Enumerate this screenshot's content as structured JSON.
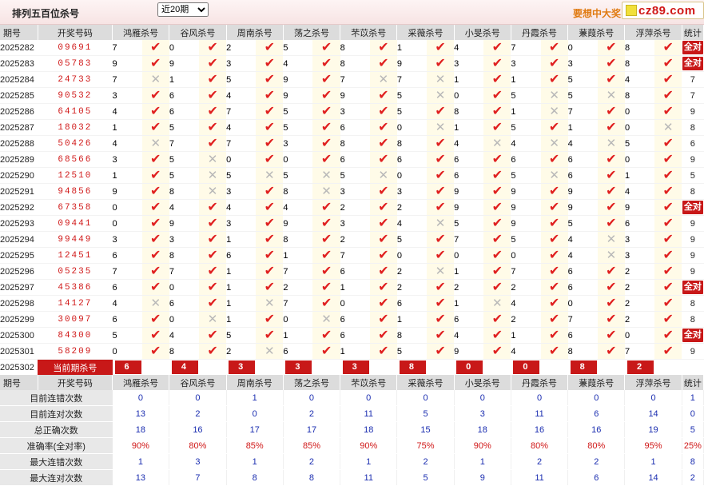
{
  "header": {
    "title": "排列五百位杀号",
    "select_value": "近20期",
    "select_options": [
      "近20期"
    ],
    "promo": "要想中大奖",
    "logo": "cz89.com"
  },
  "columns": {
    "period": "期号",
    "draw": "开奖号码",
    "experts": [
      "鸿雁杀号",
      "谷风杀号",
      "周南杀号",
      "荡之杀号",
      "芣苡杀号",
      "采薇杀号",
      "小旻杀号",
      "丹霞杀号",
      "蒹葭杀号",
      "浮萍杀号"
    ],
    "stat": "统计"
  },
  "all_right_label": "全对",
  "rows": [
    {
      "period": "2025282",
      "draw": "09691",
      "kills": [
        7,
        0,
        2,
        5,
        8,
        1,
        4,
        7,
        0,
        8
      ],
      "hits": [
        1,
        1,
        1,
        1,
        1,
        1,
        1,
        1,
        1,
        1
      ],
      "stat": "全对"
    },
    {
      "period": "2025283",
      "draw": "05783",
      "kills": [
        9,
        9,
        3,
        4,
        8,
        9,
        3,
        3,
        3,
        8
      ],
      "hits": [
        1,
        1,
        1,
        1,
        1,
        1,
        1,
        1,
        1,
        1
      ],
      "stat": "全对"
    },
    {
      "period": "2025284",
      "draw": "24733",
      "kills": [
        7,
        1,
        5,
        9,
        7,
        7,
        1,
        1,
        5,
        4
      ],
      "hits": [
        0,
        1,
        1,
        1,
        0,
        0,
        1,
        1,
        1,
        1
      ],
      "stat": "7"
    },
    {
      "period": "2025285",
      "draw": "90532",
      "kills": [
        3,
        6,
        4,
        9,
        9,
        5,
        0,
        5,
        5,
        8
      ],
      "hits": [
        1,
        1,
        1,
        1,
        1,
        0,
        1,
        0,
        0,
        1
      ],
      "stat": "7"
    },
    {
      "period": "2025286",
      "draw": "64105",
      "kills": [
        4,
        6,
        7,
        5,
        3,
        5,
        8,
        1,
        7,
        0
      ],
      "hits": [
        1,
        1,
        1,
        1,
        1,
        1,
        1,
        0,
        1,
        1
      ],
      "stat": "9"
    },
    {
      "period": "2025287",
      "draw": "18032",
      "kills": [
        1,
        5,
        4,
        5,
        6,
        0,
        1,
        5,
        1,
        0
      ],
      "hits": [
        1,
        1,
        1,
        1,
        1,
        0,
        1,
        1,
        1,
        0
      ],
      "stat": "8"
    },
    {
      "period": "2025288",
      "draw": "50426",
      "kills": [
        4,
        7,
        7,
        3,
        8,
        8,
        4,
        4,
        4,
        5
      ],
      "hits": [
        0,
        1,
        1,
        1,
        1,
        1,
        0,
        0,
        0,
        1
      ],
      "stat": "6"
    },
    {
      "period": "2025289",
      "draw": "68566",
      "kills": [
        3,
        5,
        0,
        0,
        6,
        6,
        6,
        6,
        6,
        0
      ],
      "hits": [
        1,
        0,
        1,
        1,
        1,
        1,
        1,
        1,
        1,
        1
      ],
      "stat": "9"
    },
    {
      "period": "2025290",
      "draw": "12510",
      "kills": [
        1,
        5,
        5,
        5,
        5,
        0,
        6,
        5,
        6,
        1
      ],
      "hits": [
        1,
        0,
        0,
        0,
        0,
        1,
        1,
        0,
        1,
        1
      ],
      "stat": "5"
    },
    {
      "period": "2025291",
      "draw": "94856",
      "kills": [
        9,
        8,
        3,
        8,
        3,
        3,
        9,
        9,
        9,
        4
      ],
      "hits": [
        1,
        0,
        1,
        0,
        1,
        1,
        1,
        1,
        1,
        1
      ],
      "stat": "8"
    },
    {
      "period": "2025292",
      "draw": "67358",
      "kills": [
        0,
        4,
        4,
        4,
        2,
        2,
        9,
        9,
        9,
        9
      ],
      "hits": [
        1,
        1,
        1,
        1,
        1,
        1,
        1,
        1,
        1,
        1
      ],
      "stat": "全对"
    },
    {
      "period": "2025293",
      "draw": "09441",
      "kills": [
        0,
        9,
        3,
        9,
        3,
        4,
        5,
        9,
        5,
        6
      ],
      "hits": [
        1,
        1,
        1,
        1,
        1,
        0,
        1,
        1,
        1,
        1
      ],
      "stat": "9"
    },
    {
      "period": "2025294",
      "draw": "99449",
      "kills": [
        3,
        3,
        1,
        8,
        2,
        5,
        7,
        5,
        4,
        3
      ],
      "hits": [
        1,
        1,
        1,
        1,
        1,
        1,
        1,
        1,
        0,
        1
      ],
      "stat": "9"
    },
    {
      "period": "2025295",
      "draw": "12451",
      "kills": [
        6,
        8,
        6,
        1,
        7,
        0,
        0,
        0,
        4,
        3
      ],
      "hits": [
        1,
        1,
        1,
        1,
        1,
        1,
        1,
        1,
        0,
        1
      ],
      "stat": "9"
    },
    {
      "period": "2025296",
      "draw": "05235",
      "kills": [
        7,
        7,
        1,
        7,
        6,
        2,
        1,
        7,
        6,
        2
      ],
      "hits": [
        1,
        1,
        1,
        1,
        1,
        0,
        1,
        1,
        1,
        1
      ],
      "stat": "9"
    },
    {
      "period": "2025297",
      "draw": "45386",
      "kills": [
        6,
        0,
        1,
        2,
        1,
        2,
        2,
        2,
        6,
        2
      ],
      "hits": [
        1,
        1,
        1,
        1,
        1,
        1,
        1,
        1,
        1,
        1
      ],
      "stat": "全对"
    },
    {
      "period": "2025298",
      "draw": "14127",
      "kills": [
        4,
        6,
        1,
        7,
        0,
        6,
        1,
        4,
        0,
        2
      ],
      "hits": [
        0,
        1,
        0,
        1,
        1,
        1,
        0,
        1,
        1,
        1
      ],
      "stat": "8"
    },
    {
      "period": "2025299",
      "draw": "30097",
      "kills": [
        6,
        0,
        1,
        0,
        6,
        1,
        6,
        2,
        7,
        2
      ],
      "hits": [
        1,
        0,
        1,
        0,
        1,
        1,
        1,
        1,
        1,
        1
      ],
      "stat": "8"
    },
    {
      "period": "2025300",
      "draw": "84300",
      "kills": [
        5,
        4,
        5,
        1,
        6,
        8,
        4,
        1,
        6,
        0
      ],
      "hits": [
        1,
        1,
        1,
        1,
        1,
        1,
        1,
        1,
        1,
        1
      ],
      "stat": "全对"
    },
    {
      "period": "2025301",
      "draw": "58209",
      "kills": [
        0,
        8,
        2,
        6,
        1,
        5,
        9,
        4,
        8,
        7
      ],
      "hits": [
        1,
        1,
        0,
        1,
        1,
        1,
        1,
        1,
        1,
        1
      ],
      "stat": "9"
    }
  ],
  "current": {
    "period": "2025302",
    "label": "当前期杀号",
    "predictions": [
      6,
      4,
      3,
      3,
      3,
      8,
      0,
      0,
      8,
      2
    ]
  },
  "summary": [
    {
      "label": "目前连错次数",
      "values": [
        "0",
        "0",
        "1",
        "0",
        "0",
        "0",
        "0",
        "0",
        "0",
        "0"
      ],
      "stat": "1",
      "red": false
    },
    {
      "label": "目前连对次数",
      "values": [
        "13",
        "2",
        "0",
        "2",
        "11",
        "5",
        "3",
        "11",
        "6",
        "14"
      ],
      "stat": "0",
      "red": false
    },
    {
      "label": "总正确次数",
      "values": [
        "18",
        "16",
        "17",
        "17",
        "18",
        "15",
        "18",
        "16",
        "16",
        "19"
      ],
      "stat": "5",
      "red": false
    },
    {
      "label": "准确率(全对率)",
      "values": [
        "90%",
        "80%",
        "85%",
        "85%",
        "90%",
        "75%",
        "90%",
        "80%",
        "80%",
        "95%"
      ],
      "stat": "25%",
      "red": true
    },
    {
      "label": "最大连错次数",
      "values": [
        "1",
        "3",
        "1",
        "2",
        "1",
        "2",
        "1",
        "2",
        "2",
        "1"
      ],
      "stat": "8",
      "red": false
    },
    {
      "label": "最大连对次数",
      "values": [
        "13",
        "7",
        "8",
        "8",
        "11",
        "5",
        "9",
        "11",
        "6",
        "14"
      ],
      "stat": "2",
      "red": false
    }
  ],
  "icons": {
    "check": "check-icon",
    "cross": "cross-icon"
  },
  "colors": {
    "accent_red": "#c81818",
    "number_red": "#d01818",
    "summary_blue": "#1a2db0",
    "mark_bg": "#fffbe8",
    "header_gray": "#dcdcdc"
  }
}
